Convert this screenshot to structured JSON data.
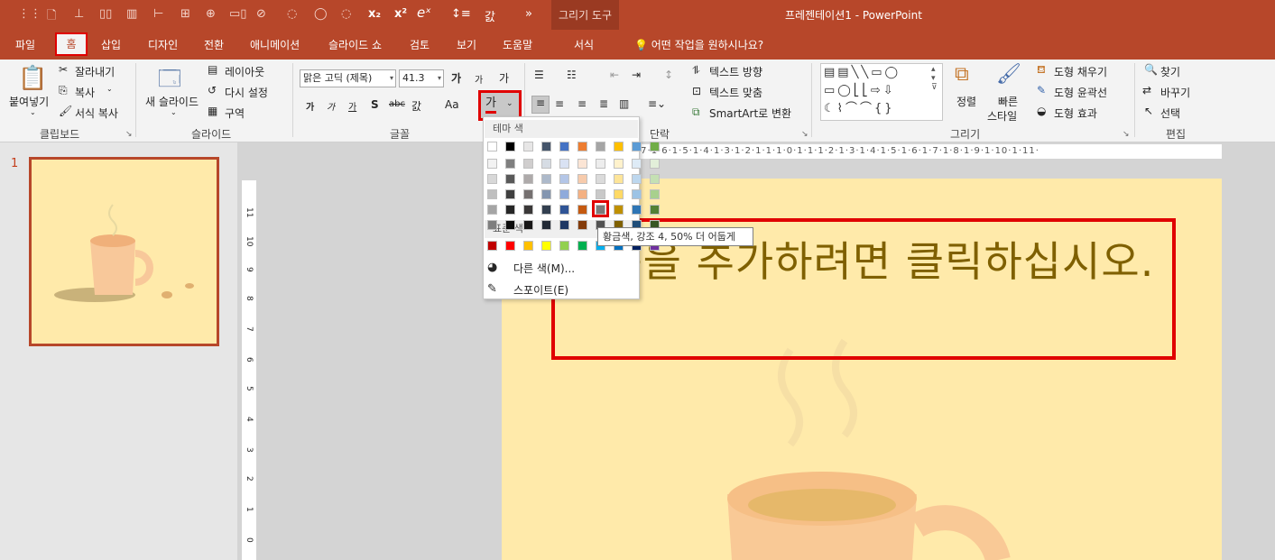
{
  "qat": {
    "icons": [
      "grid-icon",
      "new-slide-icon",
      "align-icon",
      "distribute-icon",
      "bar-chart-icon",
      "align-left-icon",
      "group-icon",
      "dual-icon",
      "shape-icon",
      "shape2-icon",
      "shape3-icon",
      "subscript-icon",
      "superscript-icon",
      "equation-icon",
      "line-spacing-icon",
      "font-color-icon",
      "more-icon"
    ],
    "x2_sub": "x₂",
    "x2_sup": "x²",
    "ex": "eˣ",
    "font_glyph": "갌"
  },
  "window": {
    "title": "프레젠테이션1 - PowerPoint",
    "context_tab_group": "그리기 도구"
  },
  "tabs": [
    "파일",
    "홈",
    "삽입",
    "디자인",
    "전환",
    "애니메이션",
    "슬라이드 쇼",
    "검토",
    "보기",
    "도움말",
    "서식"
  ],
  "tell_me": "어떤 작업을 원하시나요?",
  "ribbon": {
    "clipboard": {
      "paste": "붙여넣기",
      "cut": "잘라내기",
      "copy": "복사",
      "format_painter": "서식 복사",
      "group": "클립보드"
    },
    "slides": {
      "new_slide": "새 슬라이드",
      "layout": "레이아웃",
      "reset": "다시 설정",
      "section": "구역",
      "group": "슬라이드"
    },
    "font": {
      "font_name": "맑은 고딕 (제목)",
      "font_size": "41.3",
      "group": "글꼴",
      "grow": "가",
      "shrink": "가",
      "bold": "가",
      "italic": "가",
      "underline": "가",
      "shadow": "S",
      "strike": "abc",
      "spacing": "갌",
      "case": "Aa",
      "clear": "가",
      "font_color_glyph": "가"
    },
    "paragraph": {
      "group": "단락",
      "text_direction": "텍스트 방향",
      "align_text": "텍스트 맞춤",
      "smartart": "SmartArt로 변환"
    },
    "drawing": {
      "group": "그리기",
      "arrange": "정렬",
      "quick_styles_1": "빠른",
      "quick_styles_2": "스타일",
      "fill": "도형 채우기",
      "outline": "도형 윤곽선",
      "effects": "도형 효과"
    },
    "editing": {
      "group": "편집",
      "find": "찾기",
      "replace": "바꾸기",
      "select": "선택"
    }
  },
  "slide_pane": {
    "number": "1"
  },
  "ruler_text": "·7·1·6·1·5·1·4·1·3·1·2·1·1·1·0·1·1·1·2·1·3·1·4·1·5·1·6·1·7·1·8·1·9·1·10·1·11·",
  "vruler_numbers": [
    "11",
    "10",
    "9",
    "8",
    "7",
    "6",
    "5",
    "4",
    "3",
    "2",
    "1",
    "0"
  ],
  "slide": {
    "placeholder": "제목을 추가하려면 클릭하십시오."
  },
  "color_menu": {
    "theme_header": "테마 색",
    "standard_header": "표준 색",
    "more_colors": "다른 색(M)...",
    "eyedropper": "스포이트(E)",
    "tooltip": "황금색, 강조 4, 50% 더 어둡게",
    "theme_row": [
      "#ffffff",
      "#000000",
      "#e7e6e6",
      "#44546a",
      "#4472c4",
      "#ed7d31",
      "#a5a5a5",
      "#ffc000",
      "#5b9bd5",
      "#70ad47"
    ],
    "tints": [
      [
        "#f2f2f2",
        "#7f7f7f",
        "#d0cece",
        "#d6dce4",
        "#d9e2f3",
        "#fbe5d5",
        "#ededed",
        "#fff2cc",
        "#deebf6",
        "#e2efd9"
      ],
      [
        "#d8d8d8",
        "#595959",
        "#aeaaaa",
        "#adb9ca",
        "#b4c6e7",
        "#f7cbac",
        "#dbdbdb",
        "#fee599",
        "#bdd7ee",
        "#c5e0b3"
      ],
      [
        "#bfbfbf",
        "#3f3f3f",
        "#757070",
        "#8496b0",
        "#8eaadb",
        "#f4b183",
        "#c9c9c9",
        "#ffd965",
        "#9cc3e5",
        "#a8d08d"
      ],
      [
        "#a5a5a5",
        "#262626",
        "#3a3838",
        "#323f4f",
        "#2f5496",
        "#c55a11",
        "#7b7b7b",
        "#bf9000",
        "#2e75b5",
        "#538135"
      ],
      [
        "#7f7f7f",
        "#0c0c0c",
        "#171616",
        "#222a35",
        "#1f3864",
        "#833c0b",
        "#525252",
        "#7f6000",
        "#1f4e79",
        "#375623"
      ]
    ],
    "standard": [
      "#c00000",
      "#ff0000",
      "#ffc000",
      "#ffff00",
      "#92d050",
      "#00b050",
      "#00b0f0",
      "#0070c0",
      "#002060",
      "#7030a0"
    ]
  }
}
